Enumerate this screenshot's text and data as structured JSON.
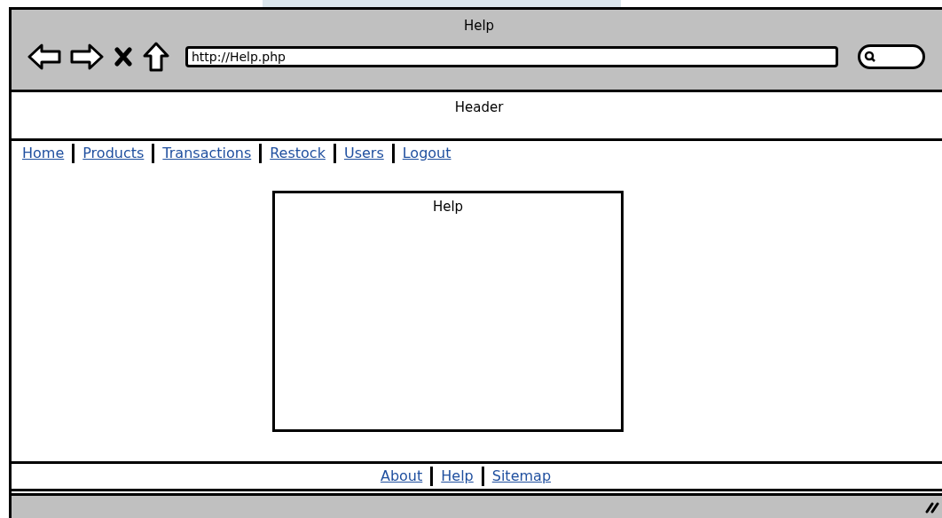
{
  "window": {
    "title": "Help"
  },
  "address_bar": {
    "value": "http://Help.php"
  },
  "header": {
    "text": "Header"
  },
  "nav_links": [
    "Home",
    "Products",
    "Transactions",
    "Restock",
    "Users",
    "Logout"
  ],
  "help_panel": {
    "title": "Help"
  },
  "footer_links": [
    "About",
    "Help",
    "Sitemap"
  ]
}
